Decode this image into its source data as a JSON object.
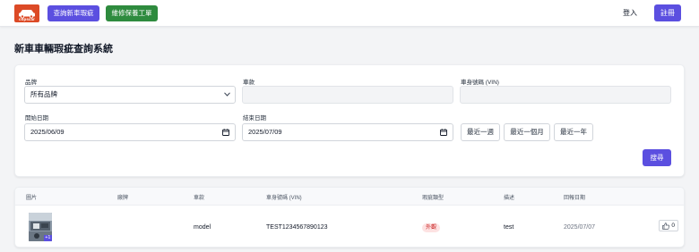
{
  "header": {
    "logo_text": "copscar",
    "query_button": "查詢新車瑕疵",
    "repair_button": "維修保養工單",
    "login": "登入",
    "register": "註冊"
  },
  "page": {
    "title": "新車車輛瑕疵查詢系統"
  },
  "filters": {
    "brand_label": "品牌",
    "brand_value": "所有品牌",
    "model_label": "車款",
    "vin_label": "車身號碼 (VIN)",
    "start_label": "開始日期",
    "start_value": "2025/06/09",
    "end_label": "結束日期",
    "end_value": "2025/07/09",
    "quick_week": "最近一週",
    "quick_month": "最近一個月",
    "quick_year": "最近一年",
    "search_button": "搜尋"
  },
  "table": {
    "headers": [
      "圖片",
      "廠牌",
      "車款",
      "車身號碼 (VIN)",
      "瑕疵類型",
      "描述",
      "回報日期"
    ],
    "rows": [
      {
        "image_extra": "+1",
        "brand": "",
        "model": "model",
        "vin": "TEST1234567890123",
        "defect_type": "外觀",
        "description": "test",
        "date": "2025/07/07",
        "likes": "0"
      }
    ]
  },
  "colors": {
    "primary": "#5b4fe0",
    "success": "#2e8b3e",
    "logo_bg": "#dc4a26",
    "tag_bg": "#fde2e2",
    "tag_text": "#c81e1e"
  }
}
